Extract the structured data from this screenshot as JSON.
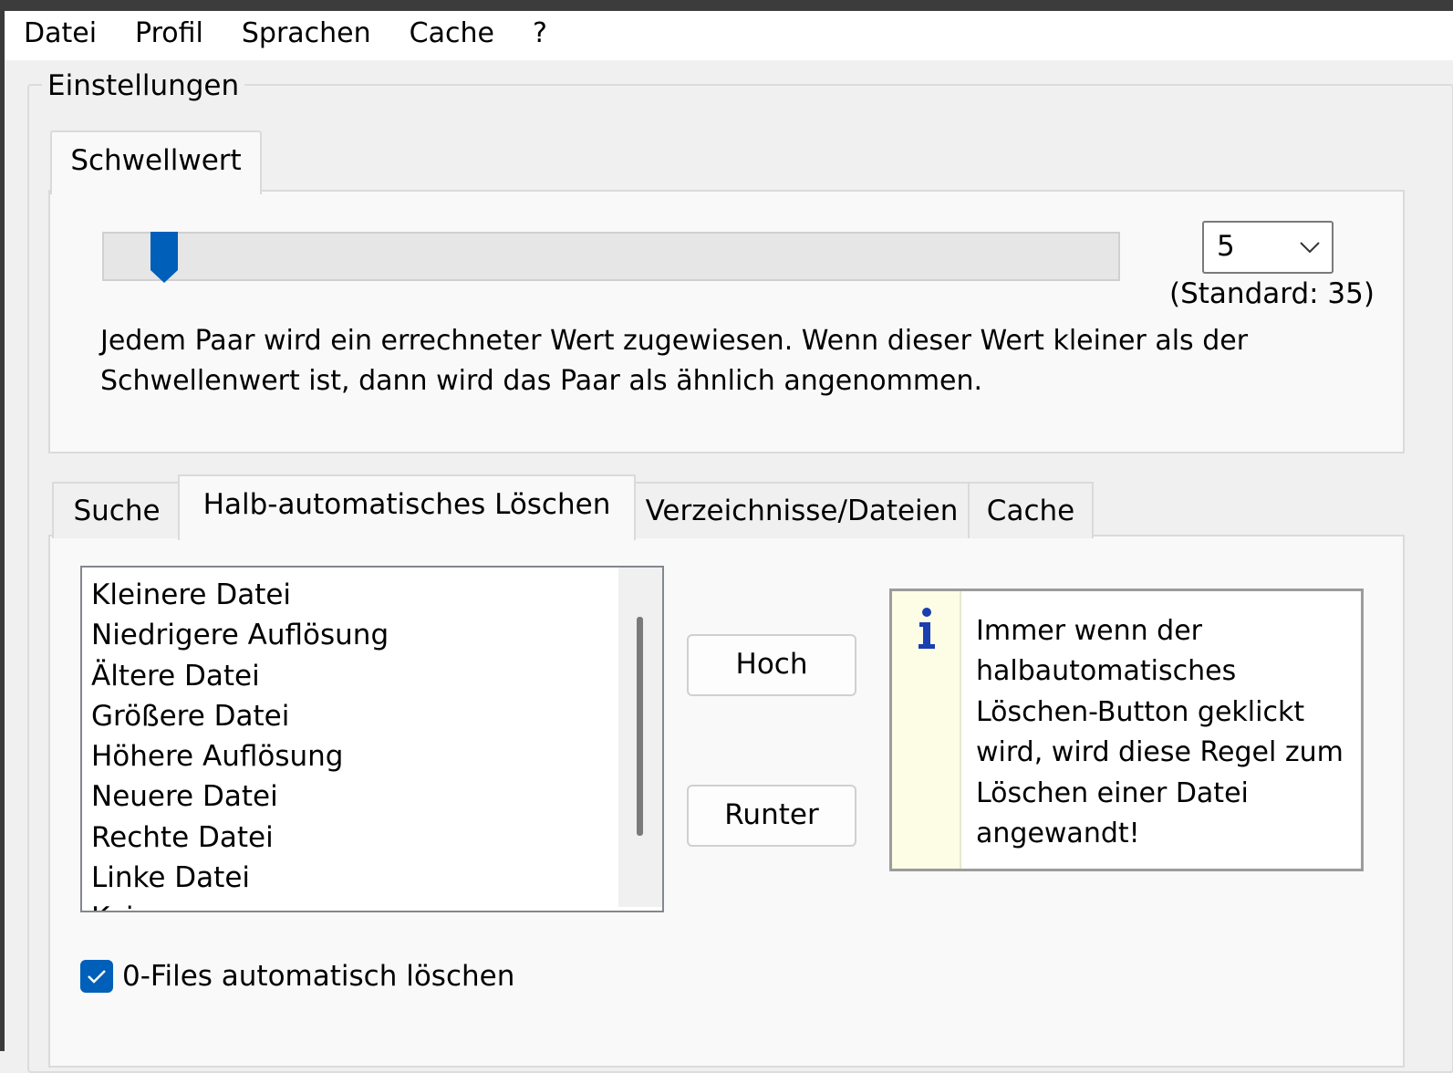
{
  "menu": {
    "items": [
      "Datei",
      "Profil",
      "Sprachen",
      "Cache",
      "?"
    ]
  },
  "settings": {
    "group_title": "Einstellungen",
    "threshold_tab": "Schwellwert",
    "threshold": {
      "value": "5",
      "slider_level": 5,
      "default_hint": "(Standard: 35)",
      "description_line1": "Jedem Paar wird ein errechneter Wert zugewiesen. Wenn dieser Wert kleiner als der",
      "description_line2": "Schwellenwert ist, dann wird das Paar als ähnlich angenommen."
    }
  },
  "tabs": [
    "Suche",
    "Halb-automatisches Löschen",
    "Verzeichnisse/Dateien",
    "Cache"
  ],
  "active_tab": "Halb-automatisches Löschen",
  "rules": {
    "items": [
      "Kleinere Datei",
      "Niedrigere Auflösung",
      "Ältere Datei",
      "Größere Datei",
      "Höhere Auflösung",
      "Neuere Datei",
      "Rechte Datei",
      "Linke Datei",
      "Kein"
    ],
    "up_button": "Hoch",
    "down_button": "Runter"
  },
  "info": {
    "line1": "Immer wenn der",
    "line2": "halbautomatisches",
    "line3": "Löschen-Button geklickt",
    "line4": "wird, wird diese Regel zum",
    "line5": "Löschen einer Datei",
    "line6": "angewandt!"
  },
  "auto_delete": {
    "label": "0-Files automatisch löschen",
    "checked": true
  },
  "colors": {
    "accent": "#005fb8",
    "info_background": "#fdfde6"
  }
}
